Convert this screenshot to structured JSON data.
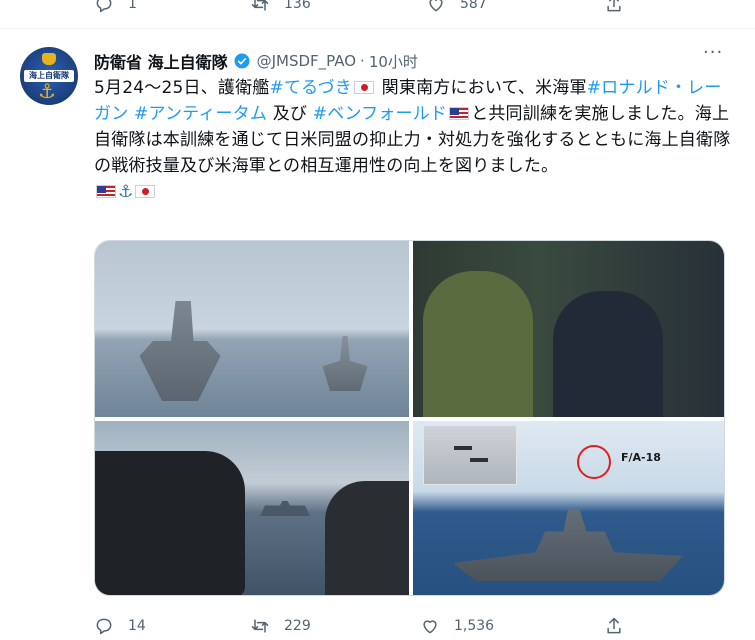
{
  "prev_tweet": {
    "reply_count": "1",
    "retweet_count": "136",
    "like_count": "587"
  },
  "tweet": {
    "display_name": "防衛省 海上自衛隊",
    "handle": "@JMSDF_PAO",
    "separator": "·",
    "time": "10小时",
    "more_label": "···",
    "avatar_text": "海上自衛隊",
    "text": {
      "t1": "5月24～25日、護衛艦",
      "tag1": "#てるづき",
      "t2": "関東南方において、米海軍",
      "tag2": "#ロナルド・レーガン",
      "tag3": "#アンティータム",
      "t3": "及び",
      "tag4": "#ベンフォールド",
      "t4": "と共同訓練を実施しました。海上自衛隊は本訓練を通じて日米同盟の抑止力・対処力を強化するとともに海上自衛隊の戦術技量及び米海軍との相互運用性の向上を図りました。"
    },
    "media_label": "F/A-18",
    "reply_count": "14",
    "retweet_count": "229",
    "like_count": "1,536"
  },
  "colors": {
    "hashtag": "#1d9bf0",
    "secondary_text": "#536471",
    "verified": "#1d9bf0"
  }
}
